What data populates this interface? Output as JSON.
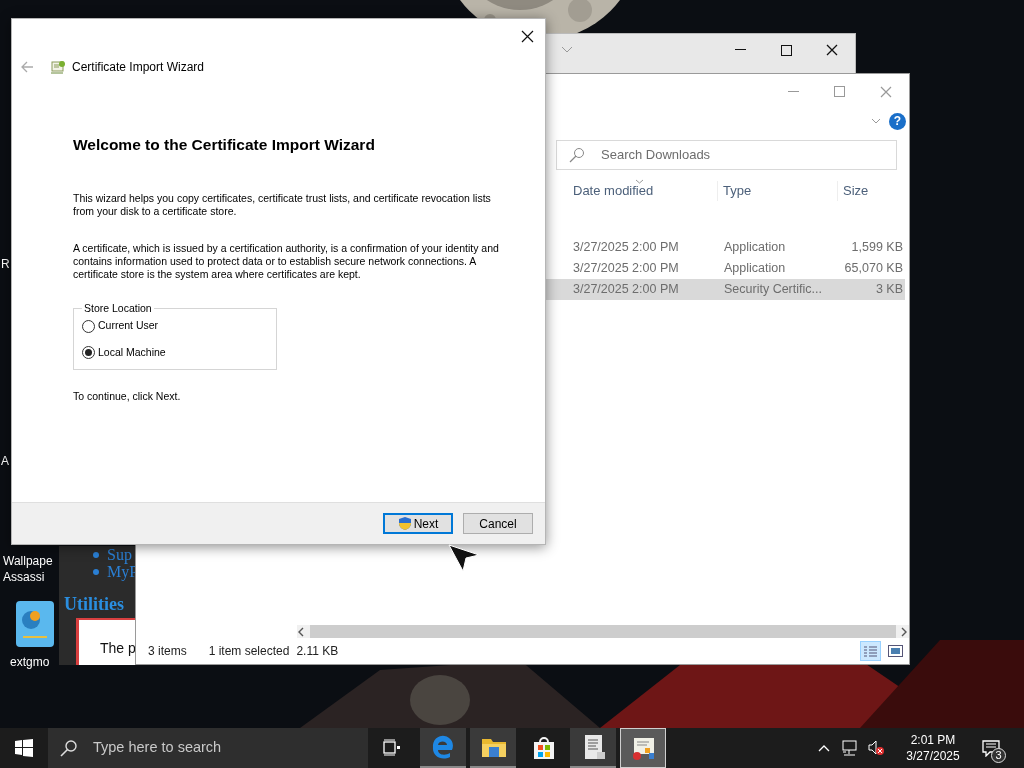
{
  "desktop_icons": [
    {
      "lines": [
        "R"
      ],
      "kind": "label"
    },
    {
      "lines": [
        "A"
      ],
      "kind": "label"
    },
    {
      "lines": [
        "Wallpape",
        "Assassi"
      ],
      "kind": "label"
    },
    {
      "lines": [
        "extgmo"
      ],
      "kind": "app"
    }
  ],
  "browser_window": {
    "links": [
      "Sup",
      "MyP"
    ],
    "heading": "Utilities",
    "box_text": "The p"
  },
  "explorer": {
    "help_glyph": "?",
    "search_placeholder": "Search Downloads",
    "columns": [
      "Date modified",
      "Type",
      "Size"
    ],
    "rows": [
      {
        "date": "3/27/2025 2:00 PM",
        "type": "Application",
        "size": "1,599 KB",
        "selected": false
      },
      {
        "date": "3/27/2025 2:00 PM",
        "type": "Application",
        "size": "65,070 KB",
        "selected": false
      },
      {
        "date": "3/27/2025 2:00 PM",
        "type": "Security Certific...",
        "size": "3 KB",
        "selected": true
      }
    ],
    "status": {
      "count": "3 items",
      "selection": "1 item selected",
      "size": "2.11 KB"
    }
  },
  "wizard": {
    "title": "Certificate Import Wizard",
    "heading": "Welcome to the Certificate Import Wizard",
    "paragraphs": [
      "This wizard helps you copy certificates, certificate trust lists, and certificate revocation lists from your disk to a certificate store.",
      "A certificate, which is issued by a certification authority, is a confirmation of your identity and contains information used to protect data or to establish secure network connections. A certificate store is the system area where certificates are kept."
    ],
    "store_location": {
      "legend": "Store Location",
      "options": [
        {
          "label": "Current User",
          "selected": false
        },
        {
          "label": "Local Machine",
          "selected": true
        }
      ]
    },
    "continue_text": "To continue, click Next.",
    "buttons": [
      {
        "label": "Next",
        "default": true,
        "shield": true
      },
      {
        "label": "Cancel",
        "default": false,
        "shield": false
      }
    ]
  },
  "taskbar": {
    "search_placeholder": "Type here to search",
    "apps": [
      {
        "kind": "edge",
        "active": true,
        "focused": false
      },
      {
        "kind": "folder",
        "active": true,
        "focused": false
      },
      {
        "kind": "store",
        "active": false,
        "focused": false
      },
      {
        "kind": "document",
        "active": true,
        "focused": false
      },
      {
        "kind": "certificate",
        "active": true,
        "focused": true
      }
    ],
    "time": "2:01 PM",
    "date": "3/27/2025",
    "notification_count": "3"
  }
}
